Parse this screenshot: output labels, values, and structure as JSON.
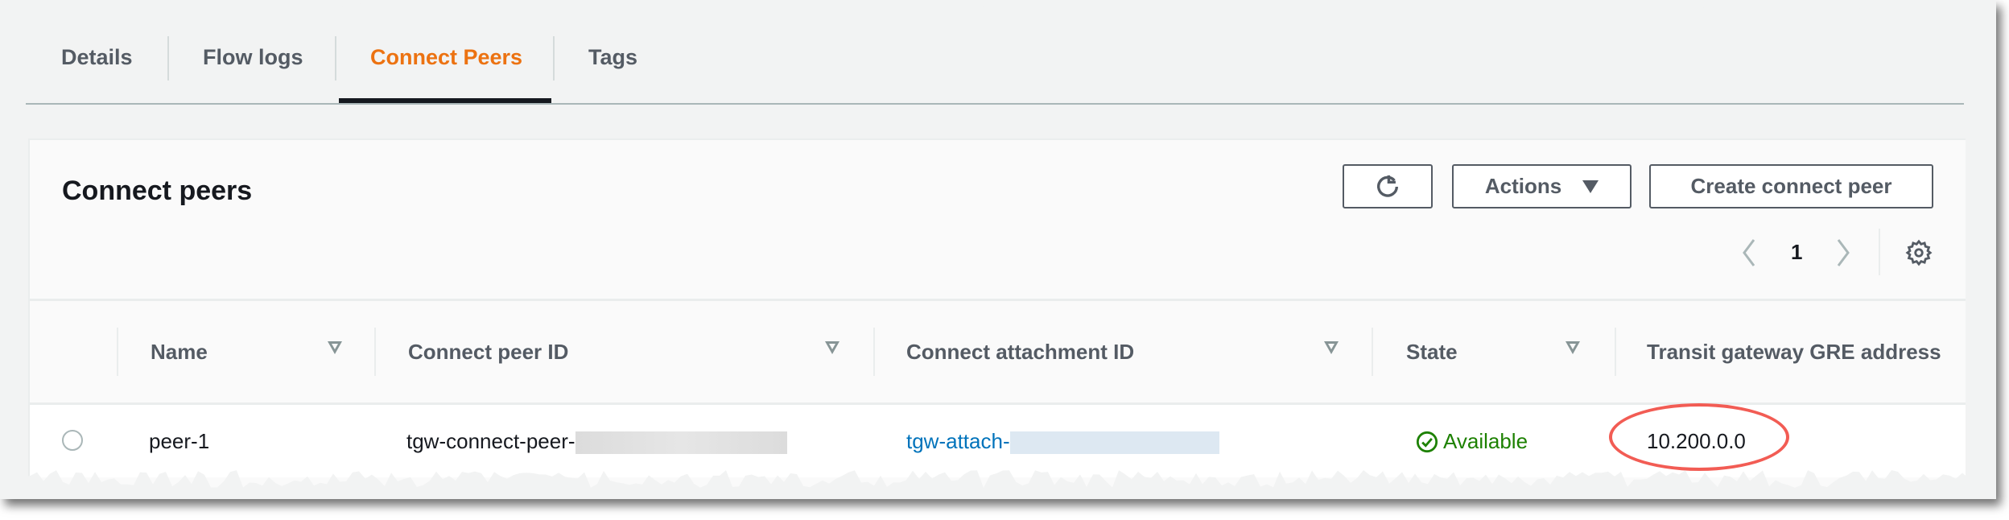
{
  "tabs": [
    {
      "label": "Details",
      "active": false
    },
    {
      "label": "Flow logs",
      "active": false
    },
    {
      "label": "Connect Peers",
      "active": true
    },
    {
      "label": "Tags",
      "active": false
    }
  ],
  "panel": {
    "title": "Connect peers",
    "refresh_icon": "refresh-icon",
    "actions_label": "Actions",
    "create_label": "Create connect peer",
    "pagination": {
      "current_page": "1"
    },
    "settings_icon": "gear-icon"
  },
  "table": {
    "columns": [
      "Name",
      "Connect peer ID",
      "Connect attachment ID",
      "State",
      "Transit gateway GRE address"
    ],
    "rows": [
      {
        "selected": false,
        "name": "peer-1",
        "peer_id": "tgw-connect-peer-",
        "attachment_id": "tgw-attach-",
        "state": "Available",
        "gre_address": "10.200.0.0"
      }
    ]
  },
  "colors": {
    "accent": "#ec7211",
    "link": "#0073bb",
    "success": "#1d8102",
    "highlight_circle": "#f25c54"
  }
}
